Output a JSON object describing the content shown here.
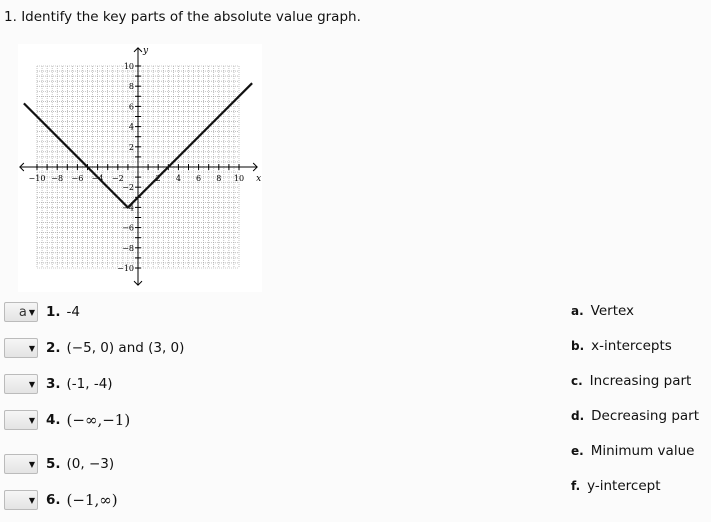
{
  "question": {
    "number": "1.",
    "text": "Identify the key parts of the absolute value graph."
  },
  "items": [
    {
      "number": "1.",
      "text": "-4",
      "selected": "a",
      "math": false
    },
    {
      "number": "2.",
      "text": "(−5, 0) and (3, 0)",
      "selected": "",
      "math": false
    },
    {
      "number": "3.",
      "text": "(-1, -4)",
      "selected": "",
      "math": false
    },
    {
      "number": "4.",
      "text": "(−∞,−1)",
      "selected": "",
      "math": true
    },
    {
      "number": "5.",
      "text": "(0, −3)",
      "selected": "",
      "math": false
    },
    {
      "number": "6.",
      "text": "(−1,∞)",
      "selected": "",
      "math": true
    }
  ],
  "options": [
    {
      "letter": "a.",
      "text": "Vertex"
    },
    {
      "letter": "b.",
      "text": "x-intercepts"
    },
    {
      "letter": "c.",
      "text": "Increasing part"
    },
    {
      "letter": "d.",
      "text": "Decreasing part"
    },
    {
      "letter": "e.",
      "text": "Minimum value"
    },
    {
      "letter": "f.",
      "text": "y-intercept"
    }
  ],
  "chart_data": {
    "type": "line",
    "xlabel": "x",
    "ylabel": "y",
    "xlim": [
      -10,
      10
    ],
    "ylim": [
      -10,
      10
    ],
    "grid": true,
    "x_ticks": [
      "−10",
      "−8",
      "−6",
      "−4",
      "−2",
      "2",
      "4",
      "6",
      "8",
      "10"
    ],
    "y_ticks": [
      "10",
      "8",
      "6",
      "4",
      "2",
      "−2",
      "−4",
      "−6",
      "−8",
      "−10"
    ],
    "series": [
      {
        "points": [
          [
            -11.3,
            6.3
          ],
          [
            -1,
            -4
          ],
          [
            11.3,
            8.3
          ]
        ]
      }
    ]
  }
}
